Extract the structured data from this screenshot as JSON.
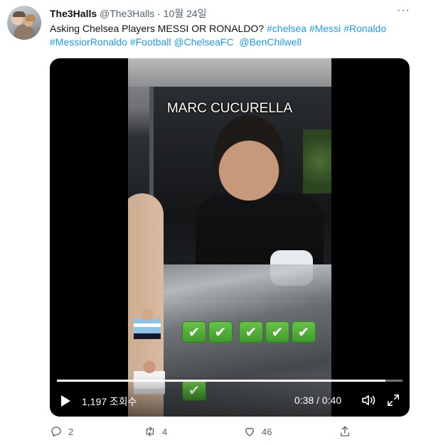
{
  "tweet": {
    "author_name": "The3Halls",
    "author_handle": "@The3Halls",
    "separator": "·",
    "date": "10월 24일",
    "text_plain": "Asking Chelsea Players MESSI OR RONALDO? ",
    "hashtags": [
      "#chelsea",
      "#Messi",
      "#Ronaldo",
      "#MessiorRonaldo",
      "#Football"
    ],
    "mentions": [
      "@ChelseaFC",
      "@BenChilwell"
    ],
    "more_label": "···"
  },
  "video": {
    "overlay_title": "MARC CUCURELLA",
    "row1_checks": [
      "✔",
      "✔",
      "✔",
      "✔",
      "✔"
    ],
    "row2_checks": [
      "✔"
    ],
    "views": "1,197 조회수",
    "time": "0:38 / 0:40",
    "progress_fraction": 0.95
  },
  "actions": {
    "reply_count": "2",
    "retweet_count": "4",
    "like_count": "46"
  },
  "icons": {
    "more": "more-icon",
    "play": "play-icon",
    "volume": "volume-icon",
    "fullscreen": "fullscreen-icon",
    "reply": "reply-icon",
    "retweet": "retweet-icon",
    "like": "heart-icon",
    "share": "share-icon"
  },
  "colors": {
    "link": "#1d9bf0",
    "muted": "#536471",
    "text": "#0f1419",
    "check_green": "#4caf3a"
  }
}
